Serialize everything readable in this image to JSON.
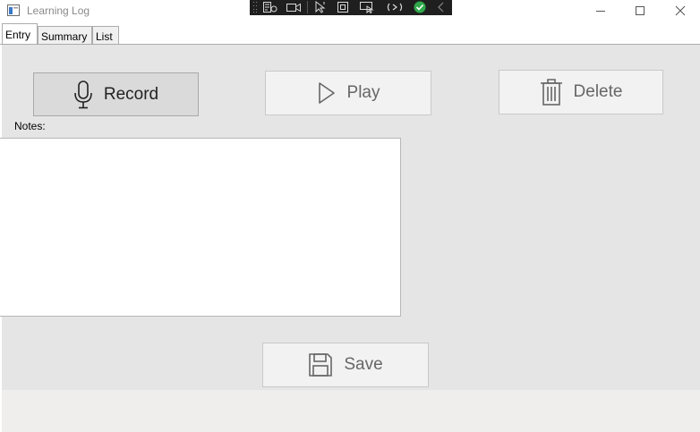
{
  "window": {
    "title": "Learning Log"
  },
  "tabs": [
    {
      "label": "Entry"
    },
    {
      "label": "Summary"
    },
    {
      "label": "List"
    }
  ],
  "buttons": {
    "record": "Record",
    "play": "Play",
    "delete": "Delete",
    "save": "Save"
  },
  "notes": {
    "label": "Notes:",
    "value": ""
  }
}
